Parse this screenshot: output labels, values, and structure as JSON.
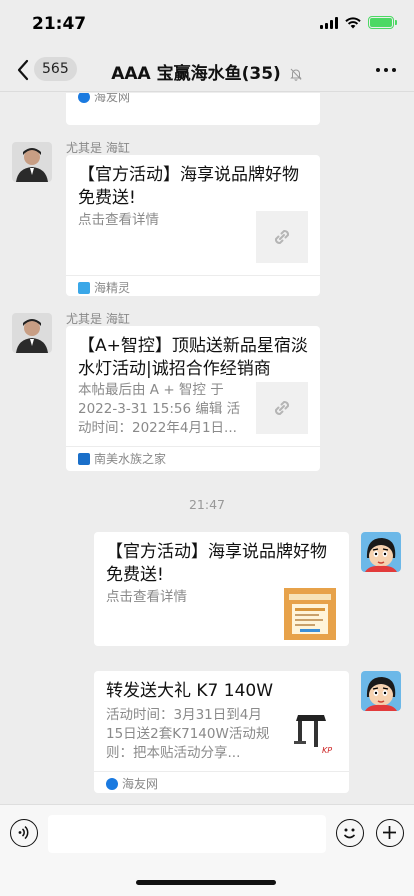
{
  "status_bar": {
    "time": "21:47"
  },
  "nav": {
    "unread_count": "565",
    "title": "AAA 宝赢海水鱼(35)"
  },
  "messages": [
    {
      "source": "海友网",
      "source_color": "#1a7ae0"
    },
    {
      "sender": "尤其是 海缸",
      "title": "【官方活动】海享说品牌好物免费送!",
      "desc": "点击查看详情",
      "thumb_icon": "link-icon",
      "source": "海精灵",
      "source_color": "#3aa7e8"
    },
    {
      "sender": "尤其是 海缸",
      "title": "【A+智控】顶贴送新品星宿淡水灯活动|诚招合作经销商",
      "desc": "本帖最后由 A + 智控 于 2022-3-31 15:56 编辑 活动时间：2022年4月1日...",
      "thumb_icon": "link-icon",
      "source": "南美水族之家",
      "source_color": "#1a6fc9"
    },
    {
      "timestamp": "21:47"
    },
    {
      "title": "【官方活动】海享说品牌好物免费送!",
      "desc": "点击查看详情",
      "thumb_icon": "poster-image"
    },
    {
      "title": "转发送大礼 K7 140W",
      "desc": "活动时间：3月31日到4月15日送2套K7140W活动规则：把本贴活动分享...",
      "thumb_icon": "lamp-product-image",
      "source": "海友网",
      "source_color": "#1a7ae0"
    }
  ],
  "input_bar": {
    "placeholder": ""
  },
  "colors": {
    "background": "#ededed",
    "bubble": "#ffffff",
    "battery": "#4cd964"
  }
}
